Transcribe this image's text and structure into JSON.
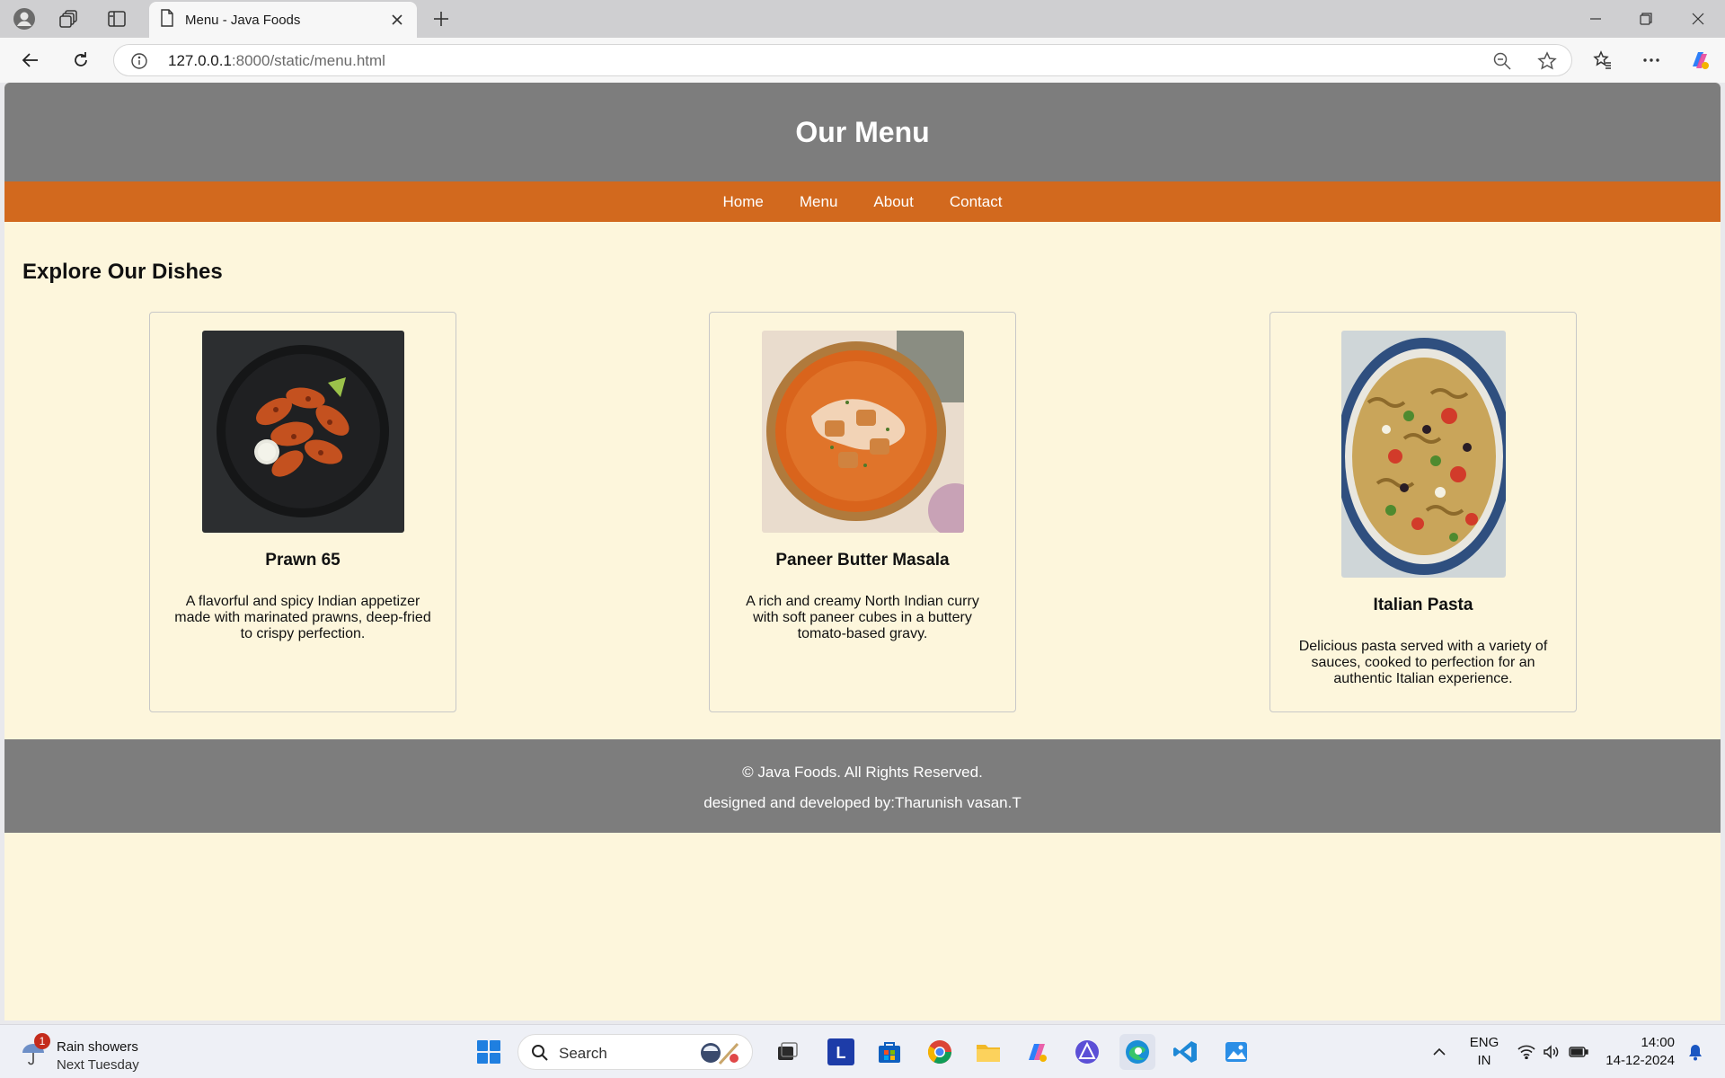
{
  "browser": {
    "tab_title": "Menu - Java Foods",
    "url_host": "127.0.0.1",
    "url_path": ":8000/static/menu.html"
  },
  "page": {
    "header_title": "Our Menu",
    "nav": [
      "Home",
      "Menu",
      "About",
      "Contact"
    ],
    "section_title": "Explore Our Dishes",
    "dishes": [
      {
        "name": "Prawn 65",
        "description": "A flavorful and spicy Indian appetizer made with marinated prawns, deep-fried to crispy perfection.",
        "image": "prawn-dish-photo"
      },
      {
        "name": "Paneer Butter Masala",
        "description": "A rich and creamy North Indian curry with soft paneer cubes in a buttery tomato-based gravy.",
        "image": "paneer-curry-photo"
      },
      {
        "name": "Italian Pasta",
        "description": "Delicious pasta served with a variety of sauces, cooked to perfection for an authentic Italian experience.",
        "image": "pasta-salad-photo"
      }
    ],
    "footer_line1": "© Java Foods. All Rights Reserved.",
    "footer_line2": "designed and developed by:Tharunish vasan.T"
  },
  "taskbar": {
    "weather_title": "Rain showers",
    "weather_sub": "Next Tuesday",
    "weather_badge": "1",
    "search_placeholder": "Search",
    "lang_top": "ENG",
    "lang_bottom": "IN",
    "time": "14:00",
    "date": "14-12-2024"
  },
  "colors": {
    "header_bg": "#7d7d7d",
    "nav_bg": "#d2691e",
    "page_bg": "#fdf6dc"
  }
}
